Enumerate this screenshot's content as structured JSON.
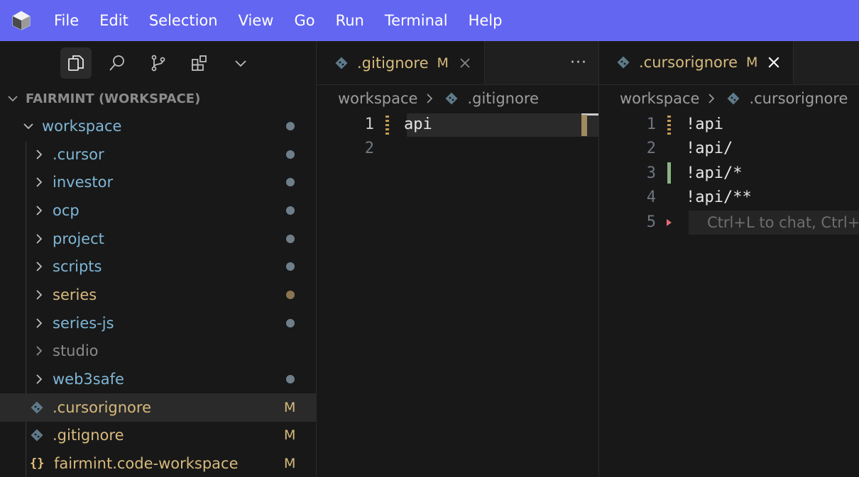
{
  "menubar": {
    "items": [
      "File",
      "Edit",
      "Selection",
      "View",
      "Go",
      "Run",
      "Terminal",
      "Help"
    ]
  },
  "sidebar": {
    "section_title": "FAIRMINT (WORKSPACE)",
    "root_folder": "workspace",
    "folders": [
      {
        "label": ".cursor",
        "status": "dot"
      },
      {
        "label": "investor",
        "status": "dot"
      },
      {
        "label": "ocp",
        "status": "dot"
      },
      {
        "label": "project",
        "status": "dot"
      },
      {
        "label": "scripts",
        "status": "dot"
      },
      {
        "label": "series",
        "status": "dot-modified"
      },
      {
        "label": "series-js",
        "status": "dot"
      },
      {
        "label": "studio",
        "status": "none"
      },
      {
        "label": "web3safe",
        "status": "dot"
      }
    ],
    "files": [
      {
        "label": ".cursorignore",
        "mark": "M",
        "selected": true
      },
      {
        "label": ".gitignore",
        "mark": "M",
        "selected": false
      },
      {
        "label": "fairmint.code-workspace",
        "mark": "M",
        "selected": false
      }
    ]
  },
  "editor_left": {
    "tab": {
      "label": ".gitignore",
      "mod": "M"
    },
    "more": "···",
    "breadcrumb": {
      "root": "workspace",
      "file": ".gitignore"
    },
    "lines": [
      {
        "num": "1",
        "text": "api"
      },
      {
        "num": "2",
        "text": ""
      }
    ]
  },
  "editor_right": {
    "tab": {
      "label": ".cursorignore",
      "mod": "M"
    },
    "breadcrumb": {
      "root": "workspace",
      "file": ".cursorignore"
    },
    "lines": [
      {
        "num": "1",
        "text": "!api"
      },
      {
        "num": "2",
        "text": "!api/"
      },
      {
        "num": "3",
        "text": "!api/*"
      },
      {
        "num": "4",
        "text": "!api/**"
      },
      {
        "num": "5",
        "text": ""
      }
    ],
    "ghost_hint": "Ctrl+L to chat, Ctrl+K to generate"
  },
  "colors": {
    "menubar_bg": "#6366f1",
    "folder_text": "#7fb6d6",
    "modified_text": "#d7ba7d",
    "gutter_added": "#89b482",
    "gutter_modified": "#c49a52"
  }
}
